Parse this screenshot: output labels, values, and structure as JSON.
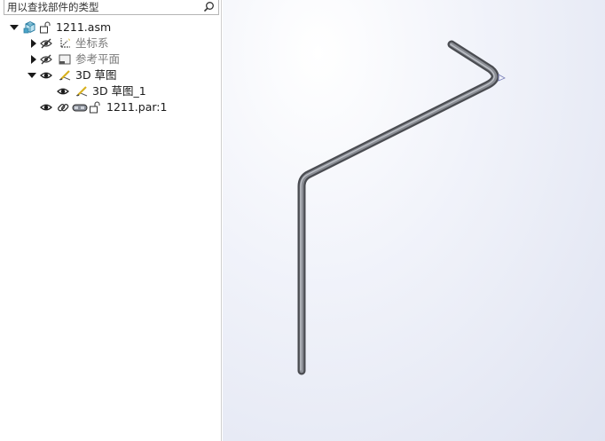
{
  "search": {
    "placeholder": "用以查找部件的类型"
  },
  "tree": {
    "root": {
      "label": "1211.asm"
    },
    "items": [
      {
        "label": "坐标系",
        "dimmed": true
      },
      {
        "label": "参考平面",
        "dimmed": true
      },
      {
        "label": "3D 草图",
        "dimmed": false
      },
      {
        "label": "3D 草图_1",
        "dimmed": false
      },
      {
        "label": "1211.par:1",
        "dimmed": false
      }
    ]
  },
  "colors": {
    "viewport_bg": "#e4e7f3",
    "pipe": "#5f6166",
    "tree_arrow": "#1a1a1a",
    "assembly_icon": "#4aa3c7",
    "sketch_icon": "#d8b11f",
    "plane_icon": "#555555"
  },
  "icons": [
    "search-icon",
    "expand-arrow-icon",
    "collapse-arrow-icon",
    "eye-icon",
    "eye-hidden-icon",
    "assembly-icon",
    "lock-icon",
    "coordinate-system-icon",
    "reference-plane-icon",
    "sketch-icon",
    "link-icon",
    "part-icon"
  ]
}
